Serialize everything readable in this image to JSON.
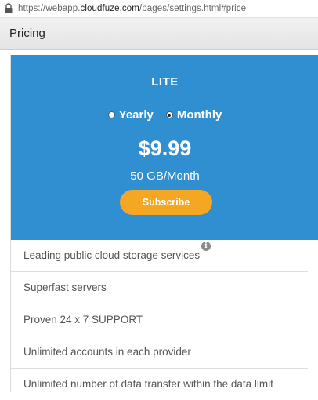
{
  "browser": {
    "url_prefix": "https://webapp.",
    "url_host": "cloudfuze.com",
    "url_suffix": "/pages/settings.html#price",
    "lock_icon": "lock-icon"
  },
  "header": {
    "title": "Pricing"
  },
  "plan": {
    "name": "LITE",
    "billing_options": [
      {
        "label": "Yearly",
        "selected": false
      },
      {
        "label": "Monthly",
        "selected": true
      }
    ],
    "price": "$9.99",
    "storage": "50 GB/Month",
    "subscribe_label": "Subscribe"
  },
  "features": [
    {
      "label": "Leading public cloud storage services",
      "info_icon": "i"
    },
    {
      "label": "Superfast servers"
    },
    {
      "label": "Proven 24 x 7 SUPPORT"
    },
    {
      "label": "Unlimited accounts in each provider"
    },
    {
      "label": "Unlimited number of data transfer within the data limit"
    }
  ],
  "colors": {
    "hero_background": "#2f8fd0",
    "subscribe_button": "#f5a623"
  }
}
